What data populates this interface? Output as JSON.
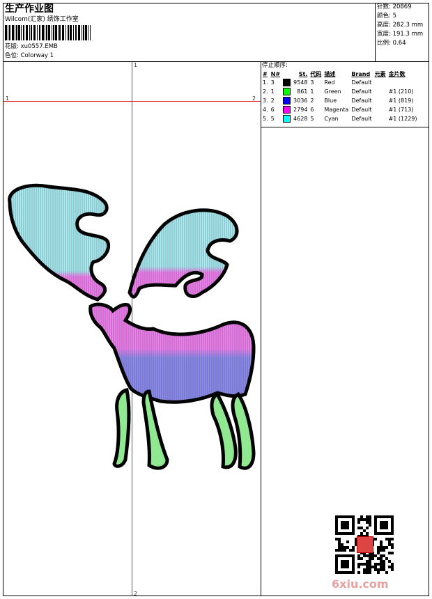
{
  "header": {
    "title": "生产作业图",
    "company": "Wilcom(汇家) 绣饰工作室",
    "design_label": "花版:",
    "design_value": "xu0557.EMB",
    "colorway_label": "色位:",
    "colorway_value": "Colorway 1"
  },
  "stats": {
    "stitches_label": "针数:",
    "stitches_value": "20869",
    "colors_label": "颜色:",
    "colors_value": "5",
    "height_label": "高度:",
    "height_value": "282.3 mm",
    "width_label": "宽度:",
    "width_value": "191.3 mm",
    "scale_label": "比例:",
    "scale_value": "0.64"
  },
  "sequence": {
    "title": "停止顺序:",
    "columns": [
      "#",
      "N#",
      "St.",
      "代码",
      "描述",
      "Brand",
      "元素",
      "金片数"
    ],
    "rows": [
      {
        "idx": "1.",
        "n": "3",
        "color": "#000000",
        "st": "9548",
        "code": "3",
        "desc": "Red",
        "brand": "Default",
        "elem": "",
        "seq": ""
      },
      {
        "idx": "2.",
        "n": "1",
        "color": "#00ff00",
        "st": "861",
        "code": "1",
        "desc": "Green",
        "brand": "Default",
        "elem": "",
        "seq": "#1 (210)"
      },
      {
        "idx": "3.",
        "n": "2",
        "color": "#0000ff",
        "st": "3036",
        "code": "2",
        "desc": "Blue",
        "brand": "Default",
        "elem": "",
        "seq": "#1 (819)"
      },
      {
        "idx": "4.",
        "n": "6",
        "color": "#ff00ff",
        "st": "2794",
        "code": "6",
        "desc": "Magenta",
        "brand": "Default",
        "elem": "",
        "seq": "#1 (713)"
      },
      {
        "idx": "5.",
        "n": "5",
        "color": "#00ffff",
        "st": "4628",
        "code": "5",
        "desc": "Cyan",
        "brand": "Default",
        "elem": "",
        "seq": "#1 (1229)"
      }
    ]
  },
  "ruler": {
    "top": "1",
    "bottom": "2",
    "left": "1",
    "right": "2"
  },
  "watermark": "6xiu.com",
  "colors": {
    "guide": "#e02020",
    "cyan": "#a8ecf4",
    "magenta": "#f080f0",
    "blue": "#8080e8",
    "green": "#80e080"
  }
}
